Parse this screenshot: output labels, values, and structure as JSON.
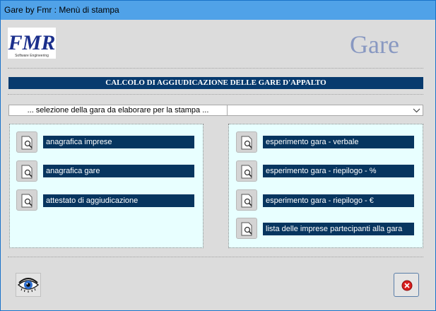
{
  "window": {
    "title": "Gare by Fmr : Menù di stampa"
  },
  "logos": {
    "fmr_text": "FMR",
    "fmr_subtitle": "Software Engineering",
    "gare_text": "Gare"
  },
  "banner": {
    "title": "CALCOLO DI AGGIUDICAZIONE DELLE GARE D'APPALTO"
  },
  "selector": {
    "label": "... selezione della gara da elaborare per la stampa ...",
    "value": ""
  },
  "left_panel": {
    "items": [
      {
        "label": "anagrafica imprese"
      },
      {
        "label": "anagrafica gare"
      },
      {
        "label": "attestato di aggiudicazione"
      }
    ]
  },
  "right_panel": {
    "items": [
      {
        "label": "esperimento gara - verbale"
      },
      {
        "label": "esperimento gara - riepilogo  -  %"
      },
      {
        "label": "esperimento gara - riepilogo  -  €"
      },
      {
        "label": "lista delle imprese partecipanti alla gara"
      }
    ]
  },
  "icons": {
    "report": "report-preview-icon",
    "preview": "eye-icon",
    "close": "close-icon",
    "dropdown": "chevron-down-icon"
  },
  "colors": {
    "titlebar": "#50a2e8",
    "banner": "#073a6e",
    "label_bg": "#07355f",
    "panel_bg": "#e8ffff",
    "close_red": "#d81e1e"
  }
}
